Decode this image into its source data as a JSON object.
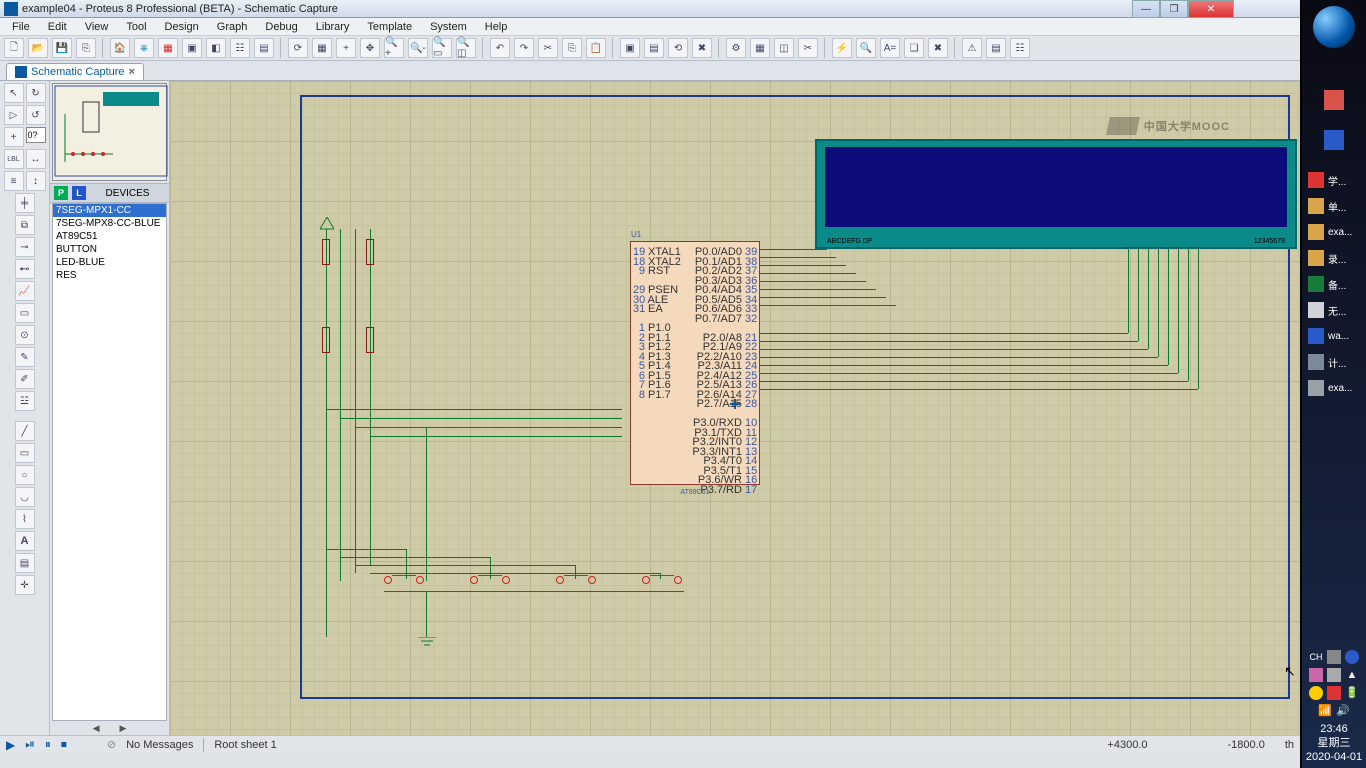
{
  "window": {
    "title": "example04 - Proteus 8 Professional (BETA) - Schematic Capture"
  },
  "menu": [
    "File",
    "Edit",
    "View",
    "Tool",
    "Design",
    "Graph",
    "Debug",
    "Library",
    "Template",
    "System",
    "Help"
  ],
  "tab": {
    "label": "Schematic Capture"
  },
  "rotation_input": "0?",
  "devices": {
    "header": "DEVICES",
    "items": [
      "7SEG-MPX1-CC",
      "7SEG-MPX8-CC-BLUE",
      "AT89C51",
      "BUTTON",
      "LED-BLUE",
      "RES"
    ],
    "selected": 0
  },
  "chip": {
    "ref": "U1",
    "name": "AT89C51",
    "left_pins": [
      "XTAL1",
      "XTAL2",
      "RST",
      "",
      "PSEN",
      "ALE",
      "EA",
      "",
      "P1.0",
      "P1.1",
      "P1.2",
      "P1.3",
      "P1.4",
      "P1.5",
      "P1.6",
      "P1.7"
    ],
    "left_nums": [
      "19",
      "18",
      "9",
      "",
      "29",
      "30",
      "31",
      "",
      "1",
      "2",
      "3",
      "4",
      "5",
      "6",
      "7",
      "8"
    ],
    "right_pins": [
      "P0.0/AD0",
      "P0.1/AD1",
      "P0.2/AD2",
      "P0.3/AD3",
      "P0.4/AD4",
      "P0.5/AD5",
      "P0.6/AD6",
      "P0.7/AD7",
      "",
      "P2.0/A8",
      "P2.1/A9",
      "P2.2/A10",
      "P2.3/A11",
      "P2.4/A12",
      "P2.5/A13",
      "P2.6/A14",
      "P2.7/A15",
      "",
      "P3.0/RXD",
      "P3.1/TXD",
      "P3.2/INT0",
      "P3.3/INT1",
      "P3.4/T0",
      "P3.5/T1",
      "P3.6/WR",
      "P3.7/RD"
    ],
    "right_nums": [
      "39",
      "38",
      "37",
      "36",
      "35",
      "34",
      "33",
      "32",
      "",
      "21",
      "22",
      "23",
      "24",
      "25",
      "26",
      "27",
      "28",
      "",
      "10",
      "11",
      "12",
      "13",
      "14",
      "15",
      "16",
      "17"
    ]
  },
  "display": {
    "label_left": "ABCDEFG  DP",
    "label_right": "12345678"
  },
  "status": {
    "messages": "No Messages",
    "sheet": "Root sheet 1",
    "coord_x": "+4300.0",
    "coord_y": "-1800.0",
    "unit": "th"
  },
  "sidebar_items": [
    {
      "icon": "#d33",
      "label": "学..."
    },
    {
      "icon": "#d9a54a",
      "label": "单..."
    },
    {
      "icon": "#d9a54a",
      "label": "exa..."
    },
    {
      "icon": "#d9a54a",
      "label": "录..."
    },
    {
      "icon": "#1a7a3a",
      "label": "备..."
    },
    {
      "icon": "#cfd3d8",
      "label": "无..."
    },
    {
      "icon": "#2a5ac8",
      "label": "wa..."
    },
    {
      "icon": "#7a8a9a",
      "label": "计..."
    },
    {
      "icon": "#9aa0a8",
      "label": "exa..."
    }
  ],
  "clock": {
    "time": "23:46",
    "dow": "星期三",
    "date": "2020-04-01"
  },
  "watermark": "中国大学MOOC",
  "tray_ch": "CH"
}
